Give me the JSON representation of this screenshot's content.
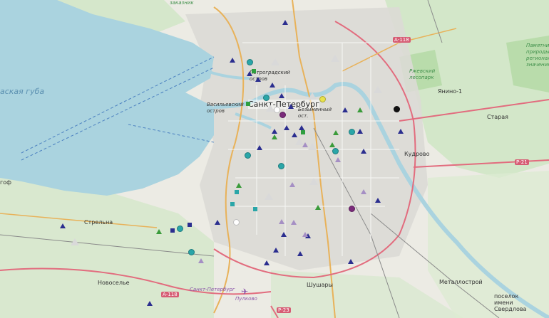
{
  "map": {
    "labels": {
      "gulf": "аская губа",
      "city": "Санкт-Петербург",
      "vasilievsky": "Васильевский остров",
      "petrogradsky": "Петроградский остров",
      "bezymyanny": "Безымянный ост.",
      "rzhevsky": "Ржевский лесопарк",
      "yanino": "Янино-1",
      "staraya": "Старая",
      "kudrovo": "Кудрово",
      "strelna": "Стрельна",
      "novoselye": "Новоселье",
      "shushary": "Шушары",
      "metallostroy": "Металлострой",
      "sverdlova": "поселок имени Свердлова",
      "peterhof": "гоф",
      "zakaznik": "заказник",
      "pulkovo": "Пулково",
      "ring": "Санкт-Петербург",
      "nature_park": "Памятник природы региональ. значения"
    },
    "road_shields": [
      "А-118",
      "Р-21",
      "А-118",
      "Р-23"
    ],
    "legend_colors": {
      "tri_dark": "#2b2e8f",
      "tri_light": "#d9d9d9",
      "tri_lilac": "#a58fc4",
      "tri_green": "#3a9b3a",
      "circle_teal": "#2aa6a8",
      "square_green": "#2f9e3f",
      "square_teal": "#2aa6a8",
      "square_navy": "#2b2e8f",
      "circle_purple": "#7a2a7a",
      "circle_yellow": "#e8e24a",
      "circle_black": "#111111",
      "circle_white": "#ffffff"
    },
    "markers": [
      {
        "kind": "tri",
        "color": "#2b2e8f"
      },
      {
        "kind": "tri",
        "color": "#2b2e8f"
      },
      {
        "kind": "tri",
        "color": "#2b2e8f"
      },
      {
        "kind": "tri",
        "color": "#2b2e8f"
      },
      {
        "kind": "tri",
        "color": "#2b2e8f"
      },
      {
        "kind": "tri",
        "color": "#2b2e8f"
      },
      {
        "kind": "tri",
        "color": "#2b2e8f"
      },
      {
        "kind": "tri",
        "color": "#2b2e8f"
      },
      {
        "kind": "tri",
        "color": "#2b2e8f"
      },
      {
        "kind": "tri",
        "color": "#2b2e8f"
      },
      {
        "kind": "tri",
        "color": "#2b2e8f"
      },
      {
        "kind": "tri",
        "color": "#2b2e8f"
      },
      {
        "kind": "tri",
        "color": "#2b2e8f"
      },
      {
        "kind": "tri",
        "color": "#2b2e8f"
      },
      {
        "kind": "tri",
        "color": "#2b2e8f"
      },
      {
        "kind": "tri",
        "color": "#2b2e8f"
      },
      {
        "kind": "tri",
        "color": "#2b2e8f"
      },
      {
        "kind": "tri",
        "color": "#2b2e8f"
      },
      {
        "kind": "tri",
        "color": "#2b2e8f"
      },
      {
        "kind": "tri",
        "color": "#2b2e8f"
      },
      {
        "kind": "tri",
        "color": "#2b2e8f"
      },
      {
        "kind": "tri",
        "color": "#2b2e8f"
      },
      {
        "kind": "tri",
        "color": "#2b2e8f"
      },
      {
        "kind": "tri",
        "color": "#2b2e8f"
      },
      {
        "kind": "tri",
        "color": "#2b2e8f"
      },
      {
        "kind": "tri",
        "color": "#2b2e8f"
      },
      {
        "kind": "tri-light",
        "color": "#d9d9d9"
      },
      {
        "kind": "tri-light",
        "color": "#d9d9d9"
      },
      {
        "kind": "tri-light",
        "color": "#d9d9d9"
      },
      {
        "kind": "tri-light",
        "color": "#d9d9d9"
      },
      {
        "kind": "tri-light",
        "color": "#d9d9d9"
      },
      {
        "kind": "tri-light",
        "color": "#d9d9d9"
      },
      {
        "kind": "tri-light",
        "color": "#d9d9d9"
      },
      {
        "kind": "tri-light",
        "color": "#d9d9d9"
      },
      {
        "kind": "tri-light",
        "color": "#d9d9d9"
      },
      {
        "kind": "tri-light",
        "color": "#d9d9d9"
      },
      {
        "kind": "tri-light",
        "color": "#d9d9d9"
      },
      {
        "kind": "tri",
        "color": "#a58fc4"
      },
      {
        "kind": "tri",
        "color": "#a58fc4"
      },
      {
        "kind": "tri",
        "color": "#a58fc4"
      },
      {
        "kind": "tri",
        "color": "#a58fc4"
      },
      {
        "kind": "tri",
        "color": "#a58fc4"
      },
      {
        "kind": "tri",
        "color": "#a58fc4"
      },
      {
        "kind": "tri",
        "color": "#a58fc4"
      },
      {
        "kind": "tri",
        "color": "#a58fc4"
      },
      {
        "kind": "tri",
        "color": "#3a9b3a"
      },
      {
        "kind": "tri",
        "color": "#3a9b3a"
      },
      {
        "kind": "tri",
        "color": "#3a9b3a"
      },
      {
        "kind": "tri",
        "color": "#3a9b3a"
      },
      {
        "kind": "tri",
        "color": "#3a9b3a"
      },
      {
        "kind": "tri",
        "color": "#3a9b3a"
      },
      {
        "kind": "tri",
        "color": "#3a9b3a"
      },
      {
        "kind": "circle",
        "color": "#2aa6a8"
      },
      {
        "kind": "circle",
        "color": "#2aa6a8"
      },
      {
        "kind": "circle",
        "color": "#2aa6a8"
      },
      {
        "kind": "circle",
        "color": "#2aa6a8"
      },
      {
        "kind": "circle",
        "color": "#2aa6a8"
      },
      {
        "kind": "circle",
        "color": "#2aa6a8"
      },
      {
        "kind": "circle",
        "color": "#2aa6a8"
      },
      {
        "kind": "circle",
        "color": "#2aa6a8"
      },
      {
        "kind": "circle",
        "color": "#7a2a7a"
      },
      {
        "kind": "circle",
        "color": "#7a2a7a"
      },
      {
        "kind": "circle",
        "color": "#e8e24a"
      },
      {
        "kind": "circle",
        "color": "#111111"
      },
      {
        "kind": "circle",
        "color": "#ffffff"
      },
      {
        "kind": "circle",
        "color": "#ffffff"
      },
      {
        "kind": "square",
        "color": "#2f9e3f"
      },
      {
        "kind": "square",
        "color": "#2f9e3f"
      },
      {
        "kind": "square",
        "color": "#2f9e3f"
      },
      {
        "kind": "square",
        "color": "#2aa6a8"
      },
      {
        "kind": "square",
        "color": "#2aa6a8"
      },
      {
        "kind": "square",
        "color": "#2aa6a8"
      },
      {
        "kind": "square",
        "color": "#2b2e8f"
      },
      {
        "kind": "square",
        "color": "#2b2e8f"
      }
    ]
  }
}
